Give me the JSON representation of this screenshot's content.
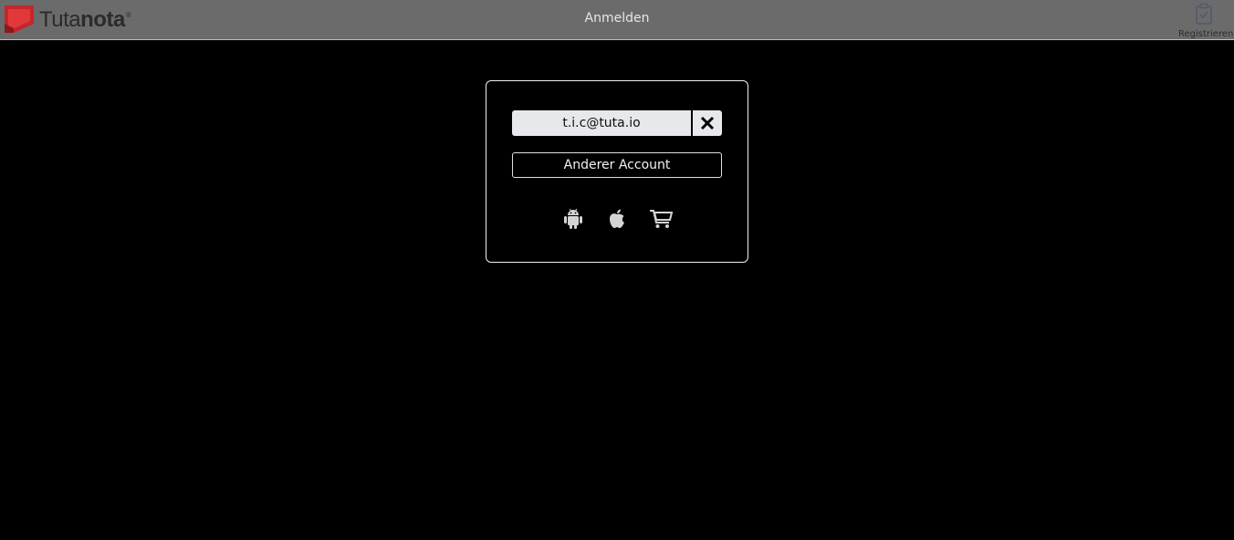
{
  "header": {
    "logo_text_part1": "Tuta",
    "logo_text_part2": "nota",
    "logo_mark": "®",
    "title": "Anmelden",
    "register_label": "Registrieren",
    "register_icon": "clipboard-check-icon"
  },
  "login": {
    "saved_account": "t.i.c@tuta.io",
    "remove_icon": "close-icon",
    "other_account_label": "Anderer Account",
    "app_icons": [
      "android-icon",
      "apple-icon",
      "cart-icon"
    ]
  },
  "colors": {
    "header_bg": "#6b6b6b",
    "page_bg": "#000000",
    "brand_red": "#c4262b",
    "account_bg": "#e6e8ec",
    "icon_fg": "#d4d4d4"
  }
}
